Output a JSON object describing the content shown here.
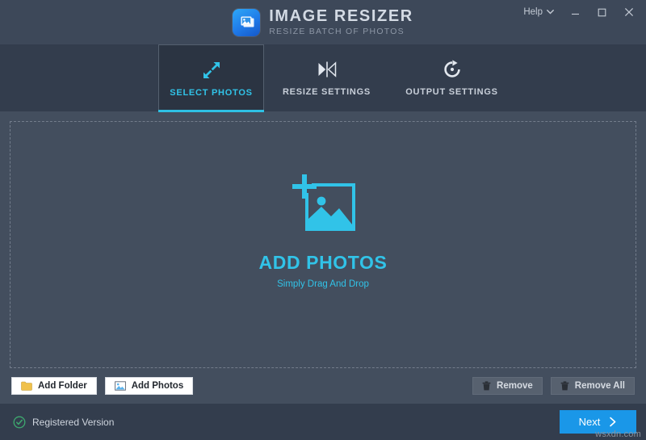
{
  "window": {
    "app_name": "IMAGE RESIZER",
    "app_tagline": "RESIZE BATCH OF PHOTOS",
    "logo_icon": "photos-stack-icon",
    "help_label": "Help",
    "help_caret_icon": "chevron-down-icon",
    "minimize_icon": "minimize-icon",
    "maximize_icon": "maximize-icon",
    "close_icon": "close-icon"
  },
  "tabs": [
    {
      "label": "SELECT PHOTOS",
      "icon": "resize-arrows-icon",
      "active": true
    },
    {
      "label": "RESIZE SETTINGS",
      "icon": "compress-width-icon",
      "active": false
    },
    {
      "label": "OUTPUT SETTINGS",
      "icon": "rotate-refresh-icon",
      "active": false
    }
  ],
  "dropzone": {
    "icon": "add-photo-frame-icon",
    "title": "ADD PHOTOS",
    "subtitle": "Simply Drag And Drop"
  },
  "actions": {
    "add_folder": {
      "label": "Add Folder",
      "icon": "folder-icon"
    },
    "add_photos": {
      "label": "Add Photos",
      "icon": "picture-icon"
    },
    "remove": {
      "label": "Remove",
      "icon": "trash-icon"
    },
    "remove_all": {
      "label": "Remove All",
      "icon": "trash-icon"
    }
  },
  "status": {
    "registration": "Registered Version",
    "registered_icon": "check-circle-icon",
    "next_label": "Next",
    "next_icon": "chevron-right-icon",
    "watermark": "wsxdn.com"
  },
  "colors": {
    "accent_cyan": "#31c3e8",
    "accent_blue": "#1a97e8",
    "titlebar_bg": "#3d4859",
    "tabbar_bg": "#333d4d",
    "body_bg": "#434e5e",
    "active_tab_bg": "#2b3442",
    "registered_green": "#3ea96f"
  }
}
